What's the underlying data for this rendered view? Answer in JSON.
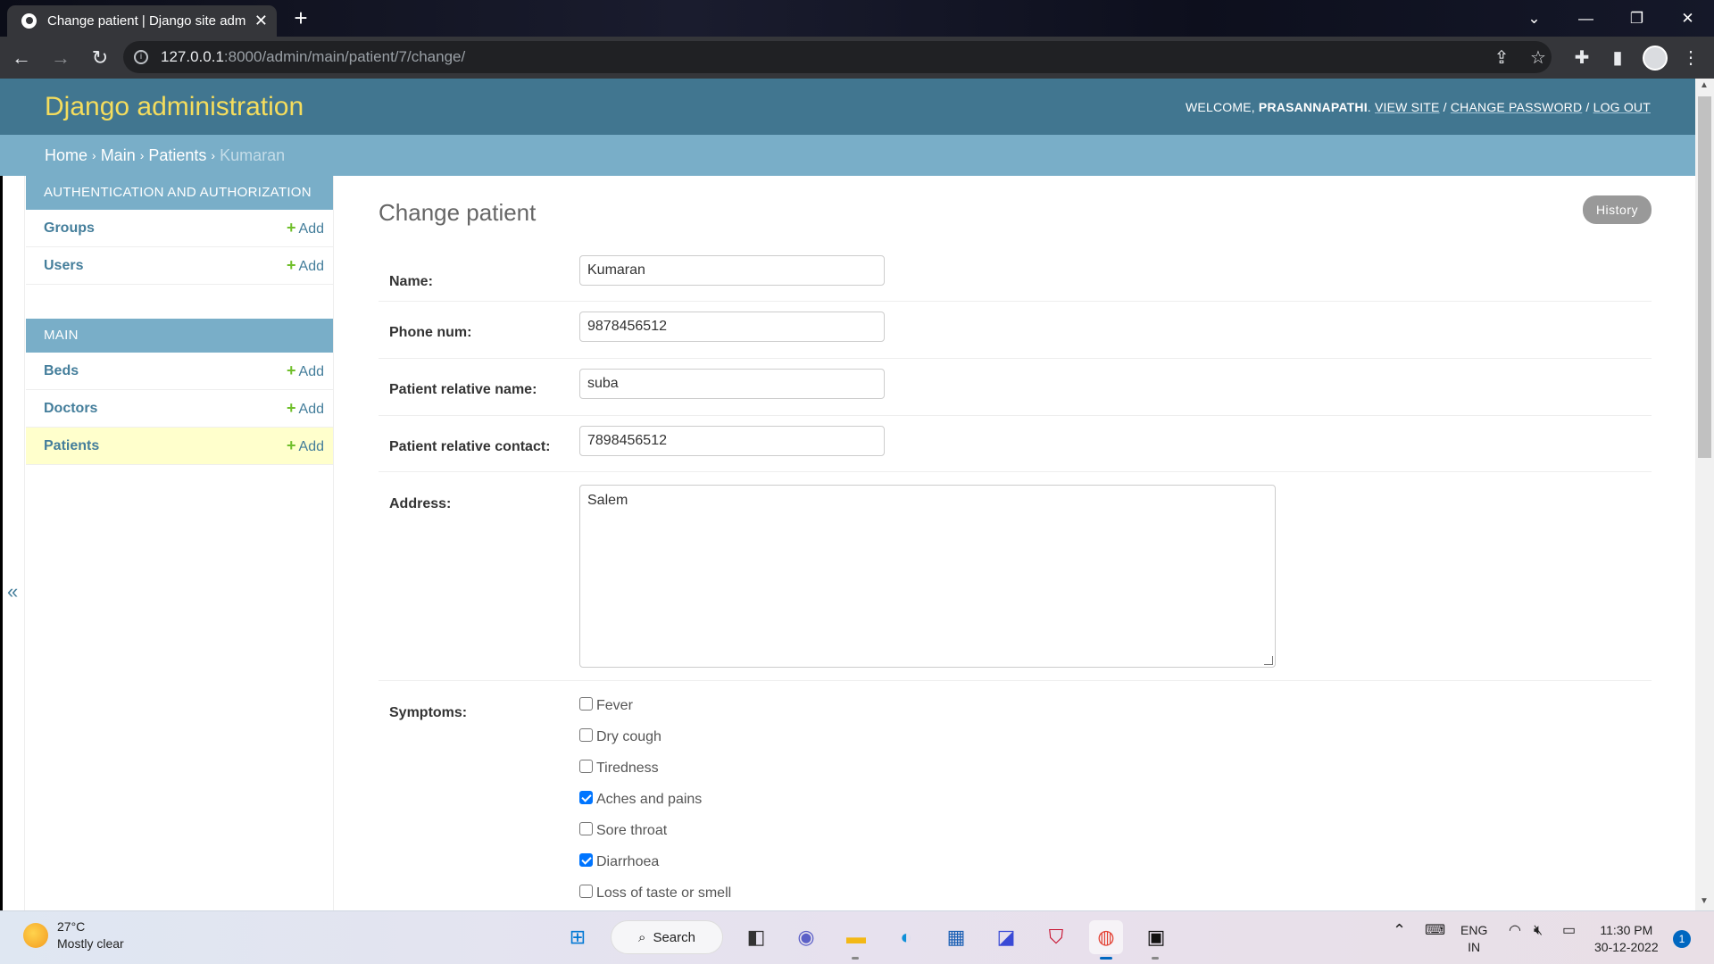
{
  "browser": {
    "tab_title": "Change patient | Django site adm",
    "url_host": "127.0.0.1",
    "url_path": ":8000/admin/main/patient/7/change/"
  },
  "header": {
    "branding": "Django administration",
    "welcome": "Welcome, ",
    "username": "Prasannapathi",
    "view_site": "View site",
    "change_password": "Change password",
    "log_out": "Log out"
  },
  "breadcrumbs": {
    "home": "Home",
    "main": "Main",
    "patients": "Patients",
    "current": "Kumaran"
  },
  "sidebar": {
    "modules": [
      {
        "caption": "Authentication and Authorization",
        "models": [
          {
            "name": "Groups",
            "add": "Add"
          },
          {
            "name": "Users",
            "add": "Add"
          }
        ]
      },
      {
        "caption": "Main",
        "models": [
          {
            "name": "Beds",
            "add": "Add"
          },
          {
            "name": "Doctors",
            "add": "Add"
          },
          {
            "name": "Patients",
            "add": "Add"
          }
        ]
      }
    ]
  },
  "form": {
    "title": "Change patient",
    "history": "History",
    "fields": [
      {
        "label": "Name:",
        "value": "Kumaran"
      },
      {
        "label": "Phone num:",
        "value": "9878456512"
      },
      {
        "label": "Patient relative name:",
        "value": "suba"
      },
      {
        "label": "Patient relative contact:",
        "value": "7898456512"
      },
      {
        "label": "Address:",
        "value": "Salem"
      }
    ],
    "symptoms_label": "Symptoms:",
    "symptoms": [
      {
        "label": "Fever",
        "checked": false
      },
      {
        "label": "Dry cough",
        "checked": false
      },
      {
        "label": "Tiredness",
        "checked": false
      },
      {
        "label": "Aches and pains",
        "checked": true
      },
      {
        "label": "Sore throat",
        "checked": false
      },
      {
        "label": "Diarrhoea",
        "checked": true
      },
      {
        "label": "Loss of taste or smell",
        "checked": false
      }
    ]
  },
  "taskbar": {
    "temperature": "27°C",
    "weather": "Mostly clear",
    "search": "Search",
    "lang": "ENG",
    "region": "IN",
    "time": "11:30 PM",
    "date": "30-12-2022",
    "notifications": "1"
  }
}
